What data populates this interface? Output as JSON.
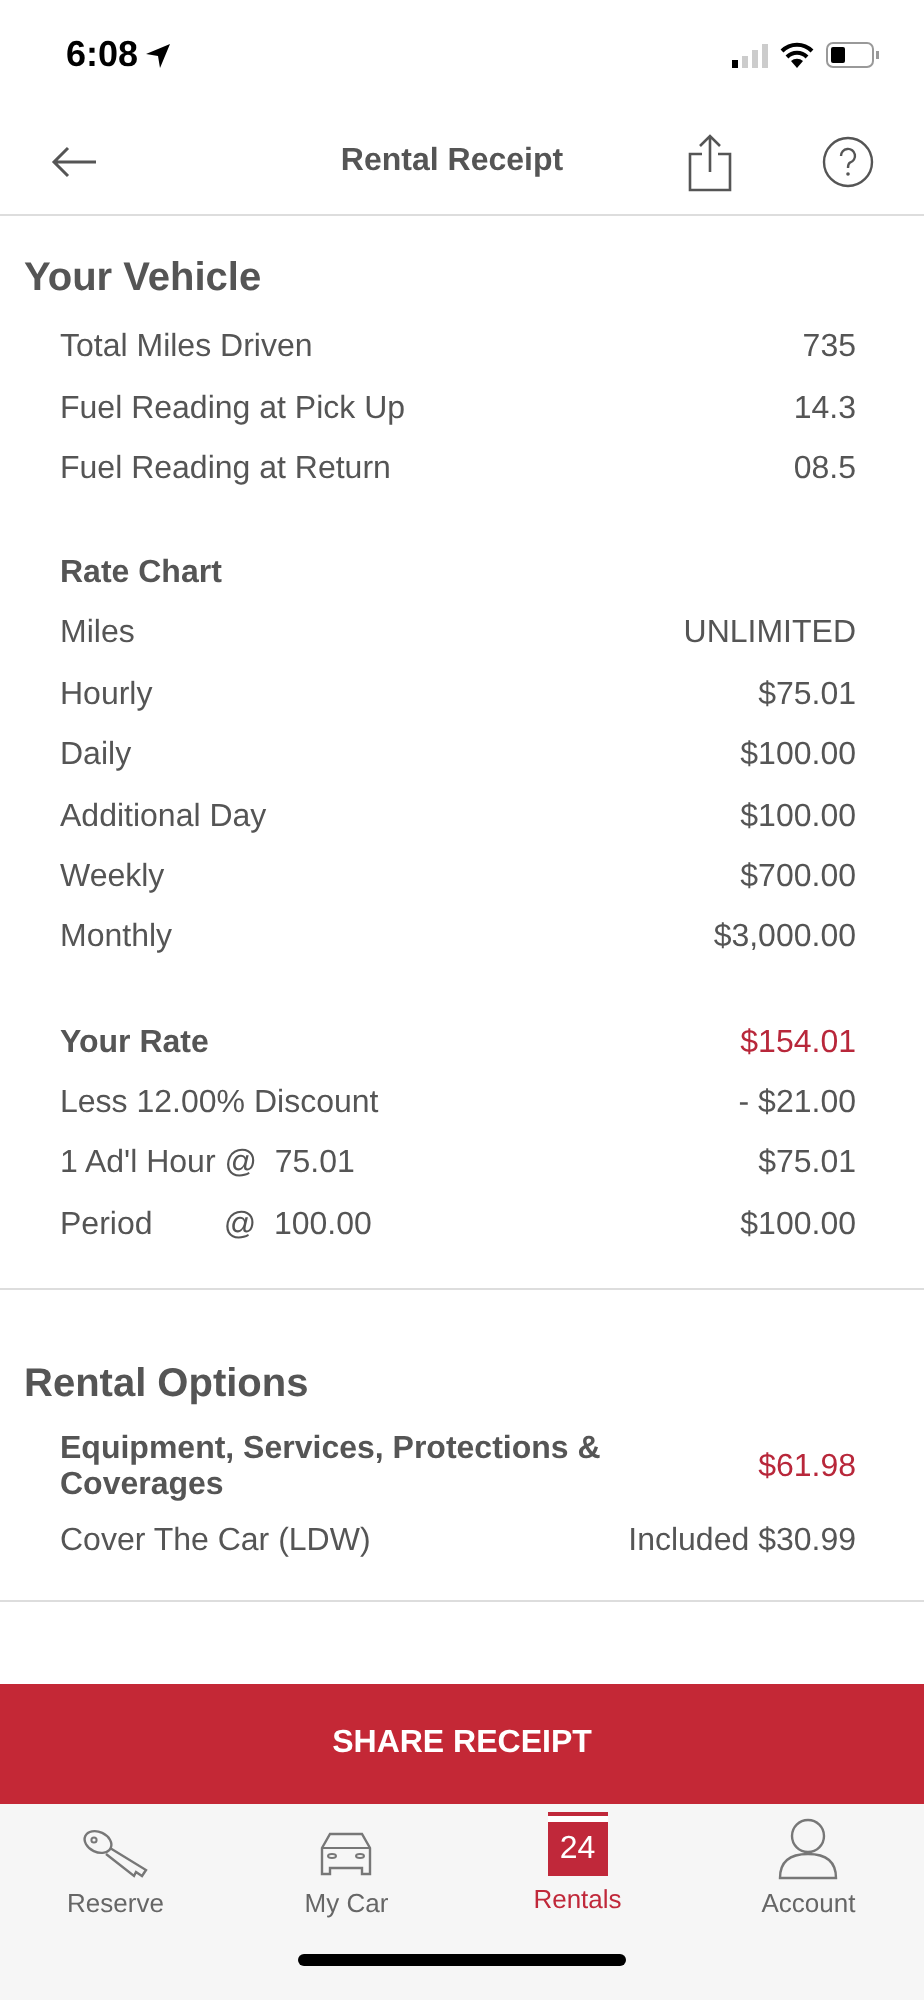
{
  "status_bar": {
    "time": "6:08"
  },
  "nav": {
    "title": "Rental Receipt"
  },
  "sections": [
    {
      "title": "Your Vehicle",
      "groups": [
        {
          "rows": [
            {
              "kind": "plain",
              "label": "Total Miles Driven",
              "value": "735"
            },
            {
              "kind": "plain",
              "label": "Fuel Reading at Pick Up",
              "value": "14.3"
            },
            {
              "kind": "plain",
              "label": "Fuel Reading at Return",
              "value": "08.5"
            }
          ]
        },
        {
          "heading": "Rate Chart",
          "rows": [
            {
              "kind": "plain",
              "label": "Miles",
              "value": "UNLIMITED"
            },
            {
              "kind": "plain",
              "label": "Hourly",
              "value": "$75.01"
            },
            {
              "kind": "plain",
              "label": "Daily",
              "value": "$100.00"
            },
            {
              "kind": "plain",
              "label": "Additional Day",
              "value": "$100.00"
            },
            {
              "kind": "plain",
              "label": "Weekly",
              "value": "$700.00"
            },
            {
              "kind": "plain",
              "label": "Monthly",
              "value": "$3,000.00"
            }
          ]
        },
        {
          "rows": [
            {
              "kind": "total",
              "label": "Your Rate",
              "value": "$154.01"
            },
            {
              "kind": "plain",
              "label": "Less 12.00% Discount",
              "value": "- $21.00"
            },
            {
              "kind": "plain",
              "label": "1 Ad'l Hour @  75.01",
              "value": "$75.01"
            },
            {
              "kind": "plain",
              "label": "Period        @  100.00",
              "value": "$100.00"
            }
          ]
        }
      ]
    },
    {
      "title": "Rental Options",
      "groups": [
        {
          "rows": [
            {
              "kind": "total",
              "label": "Equipment, Services, Protections & Coverages",
              "value": "$61.98"
            },
            {
              "kind": "plain",
              "label": "Cover The Car (LDW)",
              "value": "Included $30.99"
            }
          ]
        }
      ]
    }
  ],
  "action_button": "SHARE RECEIPT",
  "tabs": [
    {
      "kind": "key",
      "label": "Reserve",
      "selected": false
    },
    {
      "kind": "car",
      "label": "My Car",
      "selected": false
    },
    {
      "kind": "calendar",
      "label": "Rentals",
      "badge": "24",
      "selected": true
    },
    {
      "kind": "person",
      "label": "Account",
      "selected": false
    }
  ]
}
